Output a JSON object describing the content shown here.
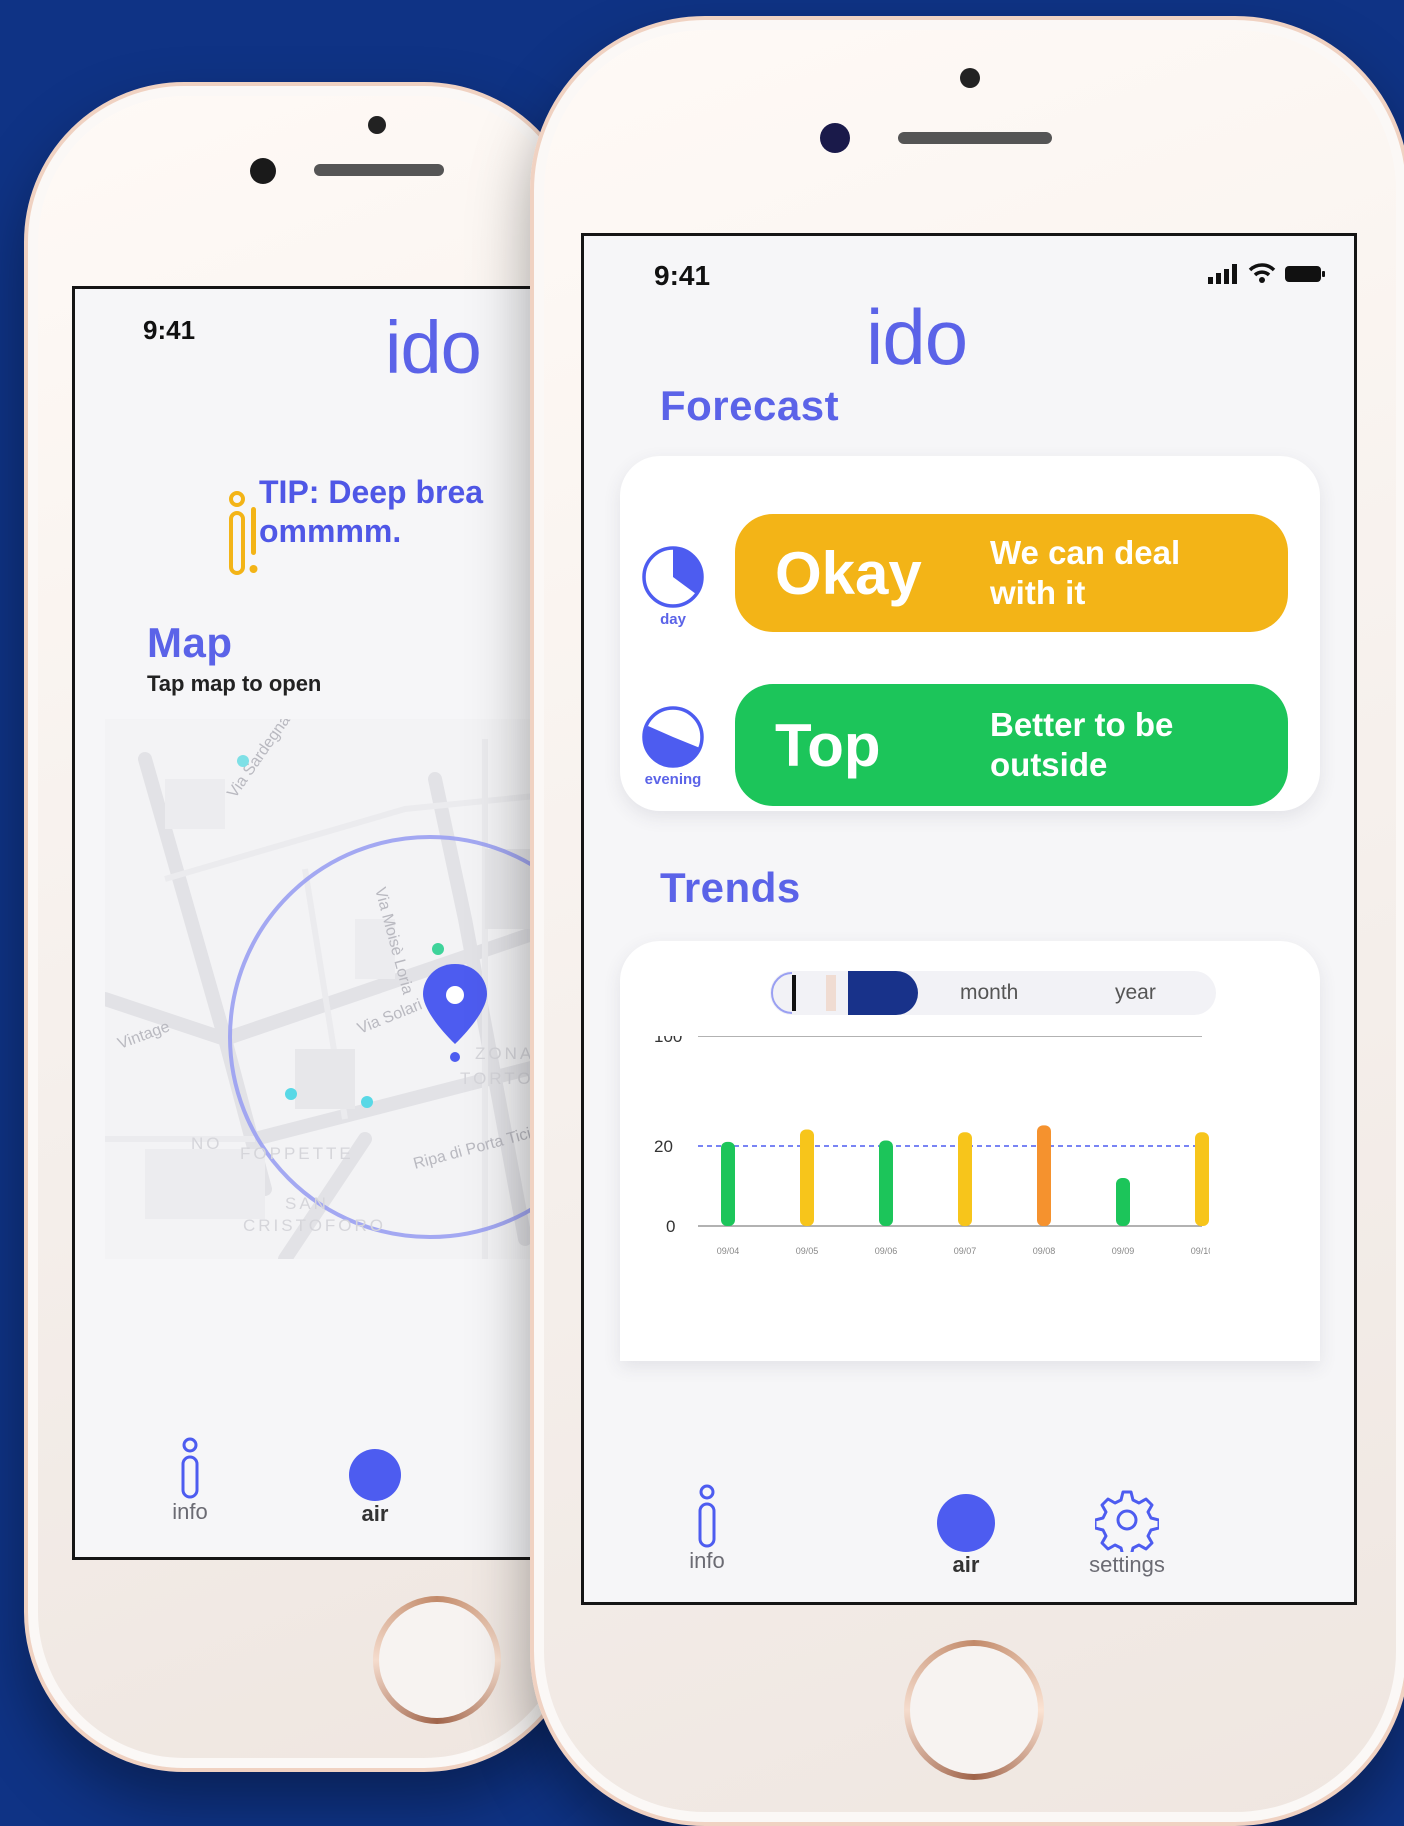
{
  "colors": {
    "background": "#0f3385",
    "brand": "#5b63e8",
    "okay": "#f3b417",
    "top": "#1cc55a",
    "bar_green": "#1cc55a",
    "bar_yellow": "#f7c51b",
    "bar_orange": "#f5922e",
    "segment_active": "#18328a"
  },
  "back_phone": {
    "time": "9:41",
    "brand": "ido",
    "tip": {
      "icon": "info-exclamation-icon",
      "line1": "TIP: Deep brea",
      "line2": "ommmm."
    },
    "map": {
      "title": "Map",
      "subtitle": "Tap map to open",
      "labels": [
        "Via Sardegna",
        "Via Moisè Loria",
        "Via Solari",
        "ZONA",
        "TORTON",
        "Ripa di Porta Ticin",
        "FOPPETTE",
        "SAN",
        "CRISTOFORO",
        "NO",
        "Vintage"
      ],
      "pin_icon": "location-pin-icon"
    },
    "tabs": [
      {
        "label": "info",
        "icon": "info-icon"
      },
      {
        "label": "air",
        "icon": "air-dot-icon"
      }
    ]
  },
  "front_phone": {
    "time": "9:41",
    "status_icons": [
      "signal-icon",
      "wifi-icon",
      "battery-icon"
    ],
    "brand": "ido",
    "forecast": {
      "title": "Forecast",
      "rows": [
        {
          "period": "day",
          "big": "Okay",
          "line1": "We can deal",
          "line2": "with it"
        },
        {
          "period": "evening",
          "big": "Top",
          "line1": "Better to be",
          "line2": "outside"
        }
      ]
    },
    "trends": {
      "title": "Trends",
      "segments": [
        "month",
        "year"
      ]
    },
    "tabs": [
      {
        "label": "info",
        "icon": "info-icon"
      },
      {
        "label": "air",
        "icon": "air-dot-icon"
      },
      {
        "label": "settings",
        "icon": "gear-icon"
      }
    ]
  },
  "chart_data": {
    "type": "bar",
    "categories": [
      "09/04",
      "09/05",
      "09/06",
      "09/07",
      "09/08",
      "09/09",
      "09/10"
    ],
    "values": [
      23,
      32,
      24,
      30,
      35,
      12,
      30
    ],
    "bar_colors": [
      "green",
      "yellow",
      "green",
      "yellow",
      "orange",
      "green",
      "yellow"
    ],
    "y_ticks": [
      "100",
      "20",
      "0"
    ],
    "threshold_line": 20,
    "title": "",
    "xlabel": "",
    "ylabel": "",
    "ylim": [
      0,
      100
    ],
    "grid": false
  }
}
